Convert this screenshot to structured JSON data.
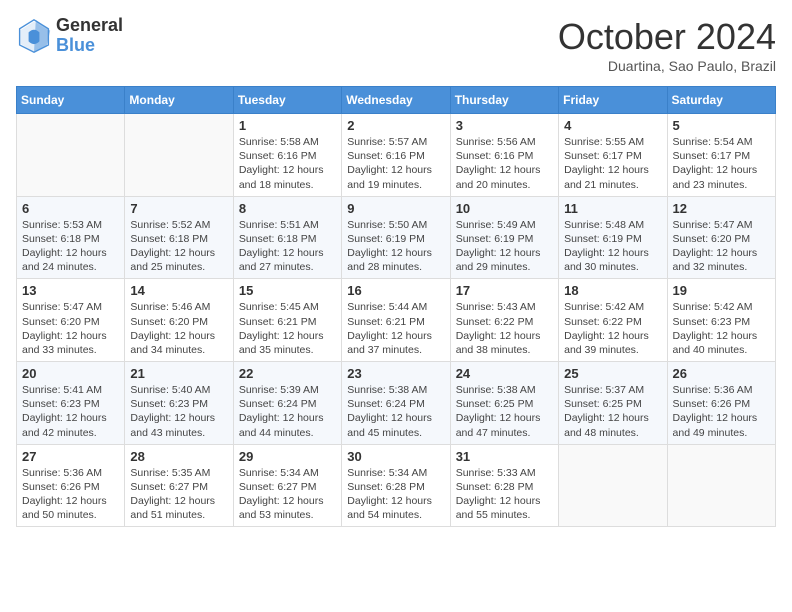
{
  "header": {
    "logo_general": "General",
    "logo_blue": "Blue",
    "month_title": "October 2024",
    "location": "Duartina, Sao Paulo, Brazil"
  },
  "days_of_week": [
    "Sunday",
    "Monday",
    "Tuesday",
    "Wednesday",
    "Thursday",
    "Friday",
    "Saturday"
  ],
  "weeks": [
    [
      {
        "day": "",
        "info": ""
      },
      {
        "day": "",
        "info": ""
      },
      {
        "day": "1",
        "info": "Sunrise: 5:58 AM\nSunset: 6:16 PM\nDaylight: 12 hours and 18 minutes."
      },
      {
        "day": "2",
        "info": "Sunrise: 5:57 AM\nSunset: 6:16 PM\nDaylight: 12 hours and 19 minutes."
      },
      {
        "day": "3",
        "info": "Sunrise: 5:56 AM\nSunset: 6:16 PM\nDaylight: 12 hours and 20 minutes."
      },
      {
        "day": "4",
        "info": "Sunrise: 5:55 AM\nSunset: 6:17 PM\nDaylight: 12 hours and 21 minutes."
      },
      {
        "day": "5",
        "info": "Sunrise: 5:54 AM\nSunset: 6:17 PM\nDaylight: 12 hours and 23 minutes."
      }
    ],
    [
      {
        "day": "6",
        "info": "Sunrise: 5:53 AM\nSunset: 6:18 PM\nDaylight: 12 hours and 24 minutes."
      },
      {
        "day": "7",
        "info": "Sunrise: 5:52 AM\nSunset: 6:18 PM\nDaylight: 12 hours and 25 minutes."
      },
      {
        "day": "8",
        "info": "Sunrise: 5:51 AM\nSunset: 6:18 PM\nDaylight: 12 hours and 27 minutes."
      },
      {
        "day": "9",
        "info": "Sunrise: 5:50 AM\nSunset: 6:19 PM\nDaylight: 12 hours and 28 minutes."
      },
      {
        "day": "10",
        "info": "Sunrise: 5:49 AM\nSunset: 6:19 PM\nDaylight: 12 hours and 29 minutes."
      },
      {
        "day": "11",
        "info": "Sunrise: 5:48 AM\nSunset: 6:19 PM\nDaylight: 12 hours and 30 minutes."
      },
      {
        "day": "12",
        "info": "Sunrise: 5:47 AM\nSunset: 6:20 PM\nDaylight: 12 hours and 32 minutes."
      }
    ],
    [
      {
        "day": "13",
        "info": "Sunrise: 5:47 AM\nSunset: 6:20 PM\nDaylight: 12 hours and 33 minutes."
      },
      {
        "day": "14",
        "info": "Sunrise: 5:46 AM\nSunset: 6:20 PM\nDaylight: 12 hours and 34 minutes."
      },
      {
        "day": "15",
        "info": "Sunrise: 5:45 AM\nSunset: 6:21 PM\nDaylight: 12 hours and 35 minutes."
      },
      {
        "day": "16",
        "info": "Sunrise: 5:44 AM\nSunset: 6:21 PM\nDaylight: 12 hours and 37 minutes."
      },
      {
        "day": "17",
        "info": "Sunrise: 5:43 AM\nSunset: 6:22 PM\nDaylight: 12 hours and 38 minutes."
      },
      {
        "day": "18",
        "info": "Sunrise: 5:42 AM\nSunset: 6:22 PM\nDaylight: 12 hours and 39 minutes."
      },
      {
        "day": "19",
        "info": "Sunrise: 5:42 AM\nSunset: 6:23 PM\nDaylight: 12 hours and 40 minutes."
      }
    ],
    [
      {
        "day": "20",
        "info": "Sunrise: 5:41 AM\nSunset: 6:23 PM\nDaylight: 12 hours and 42 minutes."
      },
      {
        "day": "21",
        "info": "Sunrise: 5:40 AM\nSunset: 6:23 PM\nDaylight: 12 hours and 43 minutes."
      },
      {
        "day": "22",
        "info": "Sunrise: 5:39 AM\nSunset: 6:24 PM\nDaylight: 12 hours and 44 minutes."
      },
      {
        "day": "23",
        "info": "Sunrise: 5:38 AM\nSunset: 6:24 PM\nDaylight: 12 hours and 45 minutes."
      },
      {
        "day": "24",
        "info": "Sunrise: 5:38 AM\nSunset: 6:25 PM\nDaylight: 12 hours and 47 minutes."
      },
      {
        "day": "25",
        "info": "Sunrise: 5:37 AM\nSunset: 6:25 PM\nDaylight: 12 hours and 48 minutes."
      },
      {
        "day": "26",
        "info": "Sunrise: 5:36 AM\nSunset: 6:26 PM\nDaylight: 12 hours and 49 minutes."
      }
    ],
    [
      {
        "day": "27",
        "info": "Sunrise: 5:36 AM\nSunset: 6:26 PM\nDaylight: 12 hours and 50 minutes."
      },
      {
        "day": "28",
        "info": "Sunrise: 5:35 AM\nSunset: 6:27 PM\nDaylight: 12 hours and 51 minutes."
      },
      {
        "day": "29",
        "info": "Sunrise: 5:34 AM\nSunset: 6:27 PM\nDaylight: 12 hours and 53 minutes."
      },
      {
        "day": "30",
        "info": "Sunrise: 5:34 AM\nSunset: 6:28 PM\nDaylight: 12 hours and 54 minutes."
      },
      {
        "day": "31",
        "info": "Sunrise: 5:33 AM\nSunset: 6:28 PM\nDaylight: 12 hours and 55 minutes."
      },
      {
        "day": "",
        "info": ""
      },
      {
        "day": "",
        "info": ""
      }
    ]
  ]
}
